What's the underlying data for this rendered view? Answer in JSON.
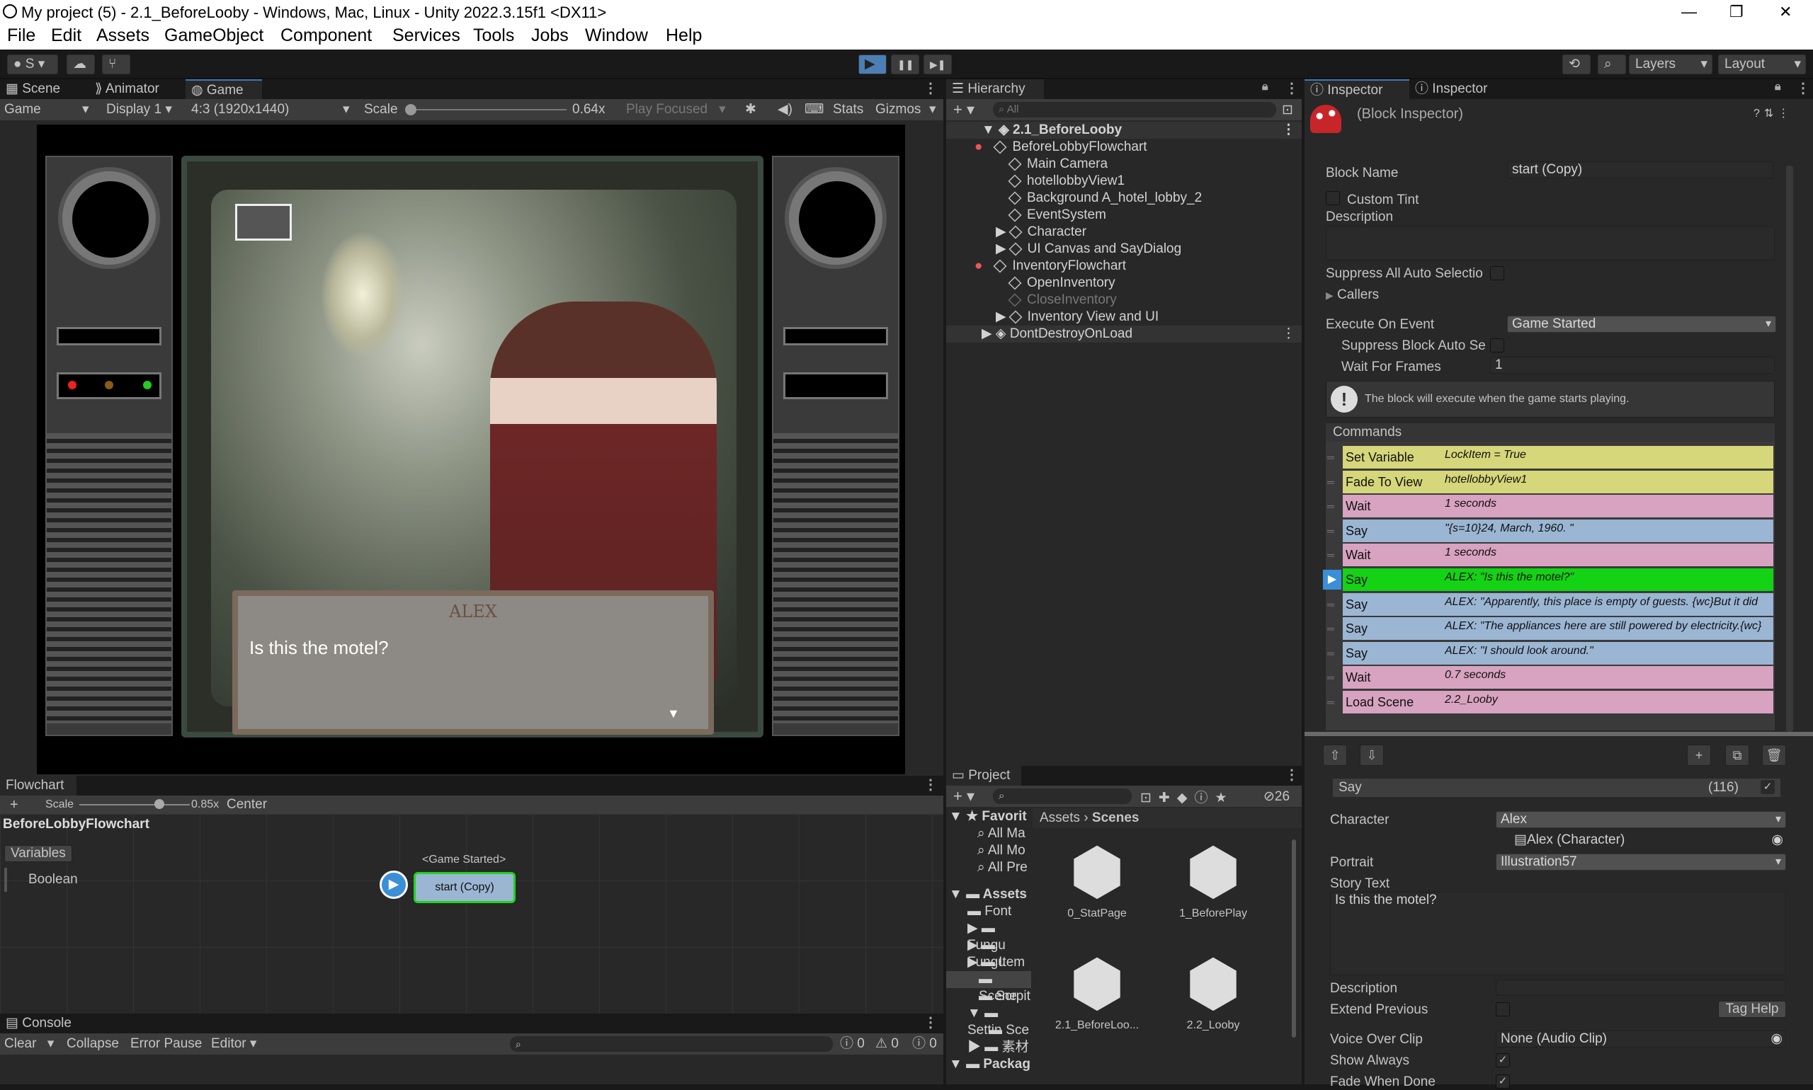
{
  "window": {
    "title": "My project (5) - 2.1_BeforeLooby - Windows, Mac, Linux - Unity 2022.3.15f1 <DX11>",
    "min": "—",
    "max": "❐",
    "close": "✕"
  },
  "menu": [
    "File",
    "Edit",
    "Assets",
    "GameObject",
    "Component",
    "Services",
    "Tools",
    "Jobs",
    "Window",
    "Help"
  ],
  "toolbar": {
    "account": "S",
    "layers": "Layers",
    "layout": "Layout",
    "play": "▶",
    "pause": "❚❚",
    "step": "▶❚"
  },
  "scene_tabs": {
    "scene": "Scene",
    "animator": "Animator",
    "game": "Game"
  },
  "game_bar": {
    "game": "Game",
    "display": "Display 1",
    "aspect": "4:3 (1920x1440)",
    "scale_label": "Scale",
    "scale_value": "0.64x",
    "play_focused": "Play Focused",
    "stats": "Stats",
    "gizmos": "Gizmos"
  },
  "game_view": {
    "speaker": "ALEX",
    "dialog": "Is this the motel?",
    "next": "▼"
  },
  "hierarchy": {
    "tab": "Hierarchy",
    "search_placeholder": "All",
    "scene": "2.1_BeforeLooby",
    "items": [
      "BeforeLobbyFlowchart",
      "Main Camera",
      "hotellobbyView1",
      "Background A_hotel_lobby_2",
      "EventSystem",
      "Character",
      "UI Canvas and SayDialog",
      "InventoryFlowchart",
      "OpenInventory",
      "CloseInventory",
      "Inventory View and UI"
    ],
    "dont_destroy": "DontDestroyOnLoad"
  },
  "inspector": {
    "tab1": "Inspector",
    "tab2": "Inspector",
    "header": "(Block Inspector)",
    "block_name_label": "Block Name",
    "block_name": "start (Copy)",
    "custom_tint": "Custom Tint",
    "description": "Description",
    "suppress_all": "Suppress All Auto Selectio",
    "callers": "Callers",
    "execute_on_event_label": "Execute On Event",
    "execute_on_event": "Game Started",
    "suppress_block": "Suppress Block Auto Se",
    "wait_frames_label": "Wait For Frames",
    "wait_frames": "1",
    "info": "The block will execute when the game starts playing.",
    "commands_label": "Commands",
    "commands": [
      {
        "name": "Set Variable",
        "value": "LockItem = True",
        "color": "#d6d67a"
      },
      {
        "name": "Fade To View",
        "value": "hotellobbyView1",
        "color": "#d6d67a"
      },
      {
        "name": "Wait",
        "value": "1 seconds",
        "color": "#d7a3c0"
      },
      {
        "name": "Say",
        "value": "\"{s=10}24, March, 1960. \"",
        "color": "#9bb6d3"
      },
      {
        "name": "Wait",
        "value": "1 seconds",
        "color": "#d7a3c0"
      },
      {
        "name": "Say",
        "value": "ALEX: \"Is this the motel?\"",
        "color": "#14d214"
      },
      {
        "name": "Say",
        "value": "ALEX: \"Apparently, this place is empty of guests. {wc}But it did",
        "color": "#9bb6d3"
      },
      {
        "name": "Say",
        "value": "ALEX: \"The appliances here are still powered by electricity.{wc}",
        "color": "#9bb6d3"
      },
      {
        "name": "Say",
        "value": "ALEX: \"I should look around.\"",
        "color": "#9bb6d3"
      },
      {
        "name": "Wait",
        "value": "0.7 seconds",
        "color": "#d7a3c0"
      },
      {
        "name": "Load Scene",
        "value": "2.2_Looby",
        "color": "#d7a3c0"
      }
    ],
    "say_title": "Say",
    "say_index": "(116)",
    "character_label": "Character",
    "character": "Alex",
    "character_obj": "Alex (Character)",
    "portrait_label": "Portrait",
    "portrait": "Illustration57",
    "story_label": "Story Text",
    "story": "Is this the motel?",
    "desc_label": "Description",
    "extend_label": "Extend Previous",
    "tag_help": "Tag Help",
    "voice_label": "Voice Over Clip",
    "voice": "None (Audio Clip)",
    "show_always": "Show Always",
    "fade_done": "Fade When Done"
  },
  "flowchart": {
    "tab": "Flowchart",
    "scale_label": "Scale",
    "scale_value": "0.85x",
    "center": "Center",
    "name": "BeforeLobbyFlowchart",
    "variables": "Variables",
    "var_type": "Boolean",
    "event": "<Game Started>",
    "block": "start (Copy)"
  },
  "project": {
    "tab": "Project",
    "count": "26",
    "breadcrumb_root": "Assets",
    "breadcrumb_leaf": "Scenes",
    "tree": [
      "Favorit",
      "All Ma",
      "All Mo",
      "All Pre",
      "Assets",
      "Font",
      "Fungu",
      "Fungu",
      "Item",
      "Scene",
      "Scrpit",
      "Settin",
      "Sce",
      "素材",
      "Packag"
    ],
    "files": [
      "0_StatPage",
      "1_BeforePlay",
      "2.1_BeforeLoo...",
      "2.2_Looby"
    ]
  },
  "console": {
    "tab": "Console",
    "clear": "Clear",
    "collapse": "Collapse",
    "error_pause": "Error Pause",
    "editor": "Editor",
    "c1": "0",
    "c2": "0",
    "c3": "0"
  }
}
